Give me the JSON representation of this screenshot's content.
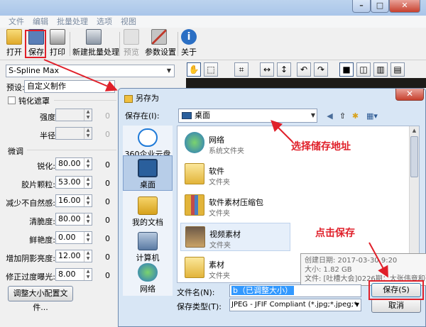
{
  "app": {
    "menu": [
      "文件",
      "编辑",
      "批量处理",
      "选项",
      "视图"
    ],
    "toolbar": {
      "open": "打开",
      "save": "保存",
      "print": "打印",
      "batch": "新建批量处理",
      "preview": "预览",
      "params": "参数设置",
      "about": "关于"
    },
    "algorithm": "S-Spline Max",
    "preset_label": "预设:",
    "preset_value": "自定义制作",
    "unsharp": {
      "checkbox_label": "钝化遮罩",
      "strength_label": "强度:",
      "radius_label": "半径:",
      "strength_zero": "0",
      "radius_zero": "0"
    },
    "finetune": {
      "title": "微调",
      "rows": [
        {
          "label": "锐化:",
          "value": "80.00",
          "zero": "0"
        },
        {
          "label": "胶片颗粒:",
          "value": "53.00",
          "zero": "0"
        },
        {
          "label": "减少不自然感:",
          "value": "16.00",
          "zero": "0"
        },
        {
          "label": "清脆度:",
          "value": "80.00",
          "zero": "0"
        },
        {
          "label": "鲜艳度:",
          "value": "0.00",
          "zero": "0"
        },
        {
          "label": "增加阴影亮度:",
          "value": "12.00",
          "zero": "0"
        },
        {
          "label": "修正过度曝光:",
          "value": "8.00",
          "zero": "0"
        }
      ]
    },
    "resize_button": "调整大小配置文件..."
  },
  "dialog": {
    "title": "另存为",
    "save_in_label": "保存在(I):",
    "location": "桌面",
    "places": [
      "360企业云盘",
      "桌面",
      "我的文档",
      "计算机",
      "网络"
    ],
    "files": [
      {
        "name": "网络",
        "type": "系统文件夹"
      },
      {
        "name": "软件",
        "type": "文件夹"
      },
      {
        "name": "软件素材压缩包",
        "type": "文件夹"
      },
      {
        "name": "视频素材",
        "type": "文件夹"
      },
      {
        "name": "素材",
        "type": "文件夹"
      }
    ],
    "tooltip": {
      "created": "创建日期: 2017-03-30 9:20",
      "size": "大小: 1.82 GB",
      "files": "文件: [吐槽大会]0226期：大张伟竟和张雨绮"
    },
    "filename_label": "文件名(N):",
    "filename_value": "b（已调整大小）",
    "filetype_label": "保存类型(T):",
    "filetype_value": "JPEG - JFIF Compliant (*.jpg;*.jpeg;*",
    "save_button": "保存(S)",
    "cancel_button": "取消"
  },
  "annotations": {
    "choose_location": "选择储存地址",
    "click_save": "点击保存"
  },
  "colors": {
    "annotation_red": "#e0202a",
    "selection_blue": "#3399ff",
    "dialog_bg": "#d8e6f5"
  }
}
